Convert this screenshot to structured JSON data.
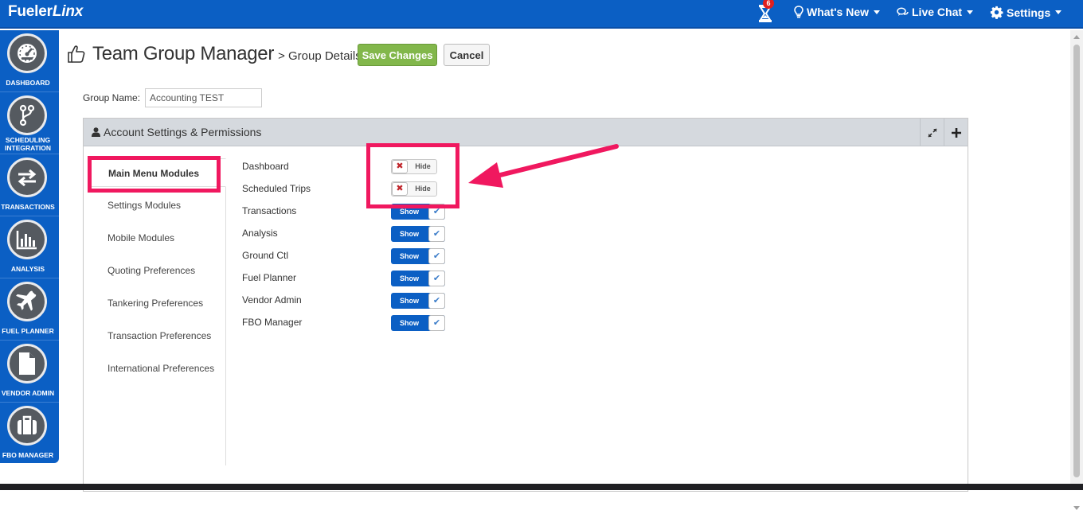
{
  "topbar": {
    "logo_main": "Fueler",
    "logo_italic": "Linx",
    "notification_count": "6",
    "whats_new": "What's New",
    "live_chat": "Live Chat",
    "settings": "Settings"
  },
  "sidebar": {
    "items": [
      {
        "label": "DASHBOARD",
        "icon": "dashboard-gauge-icon"
      },
      {
        "label": "SCHEDULING INTEGRATION",
        "icon": "branch-icon"
      },
      {
        "label": "TRANSACTIONS",
        "icon": "exchange-arrows-icon"
      },
      {
        "label": "ANALYSIS",
        "icon": "bar-chart-icon"
      },
      {
        "label": "FUEL PLANNER",
        "icon": "airplane-icon"
      },
      {
        "label": "VENDOR ADMIN",
        "icon": "document-icon"
      },
      {
        "label": "FBO MANAGER",
        "icon": "briefcase-icon"
      }
    ]
  },
  "header": {
    "title": "Team Group Manager",
    "breadcrumb": "> Group Details",
    "save_label": "Save Changes",
    "cancel_label": "Cancel"
  },
  "group": {
    "label": "Group Name:",
    "value": "Accounting TEST"
  },
  "panel": {
    "title": "Account Settings & Permissions"
  },
  "tabs": [
    {
      "label": "Main Menu Modules",
      "active": true
    },
    {
      "label": "Settings Modules"
    },
    {
      "label": "Mobile Modules"
    },
    {
      "label": "Quoting Preferences"
    },
    {
      "label": "Tankering Preferences"
    },
    {
      "label": "Transaction Preferences"
    },
    {
      "label": "International Preferences"
    }
  ],
  "modules": [
    {
      "label": "Dashboard",
      "state": "Hide"
    },
    {
      "label": "Scheduled Trips",
      "state": "Hide"
    },
    {
      "label": "Transactions",
      "state": "Show"
    },
    {
      "label": "Analysis",
      "state": "Show"
    },
    {
      "label": "Ground Ctl",
      "state": "Show"
    },
    {
      "label": "Fuel Planner",
      "state": "Show"
    },
    {
      "label": "Vendor Admin",
      "state": "Show"
    },
    {
      "label": "FBO Manager",
      "state": "Show"
    }
  ],
  "colors": {
    "brand_blue": "#0b5fc4",
    "save_green": "#82b74b",
    "highlight_pink": "#f0185f"
  }
}
